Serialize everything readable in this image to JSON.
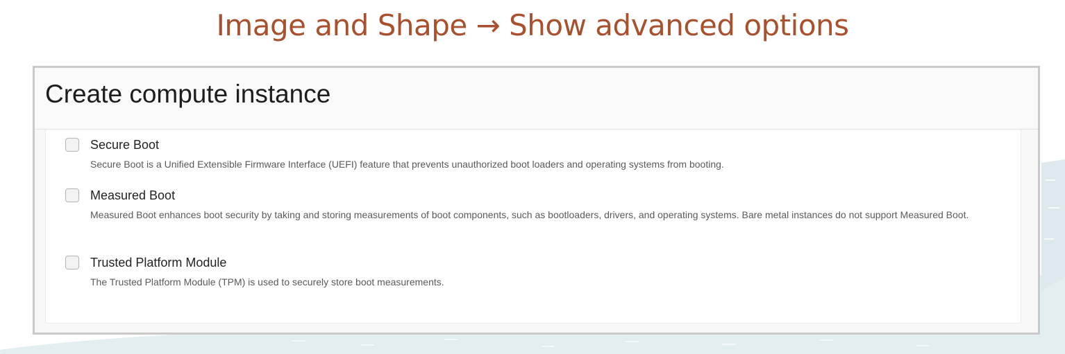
{
  "slide": {
    "title": "Image and Shape → Show advanced options"
  },
  "dialog": {
    "title": "Create compute instance"
  },
  "options": [
    {
      "label": "Secure Boot",
      "description": "Secure Boot is a Unified Extensible Firmware Interface (UEFI) feature that prevents unauthorized boot loaders and operating systems from booting.",
      "checked": false
    },
    {
      "label": "Measured Boot",
      "description": "Measured Boot enhances boot security by taking and storing measurements of boot components, such as bootloaders, drivers, and operating systems. Bare metal instances do not support Measured Boot.",
      "checked": false
    },
    {
      "label": "Trusted Platform Module",
      "description": "The Trusted Platform Module (TPM) is used to securely store boot measurements.",
      "checked": false
    }
  ],
  "colors": {
    "title_accent": "#a8512f",
    "background_wave": "#dde9ec"
  }
}
